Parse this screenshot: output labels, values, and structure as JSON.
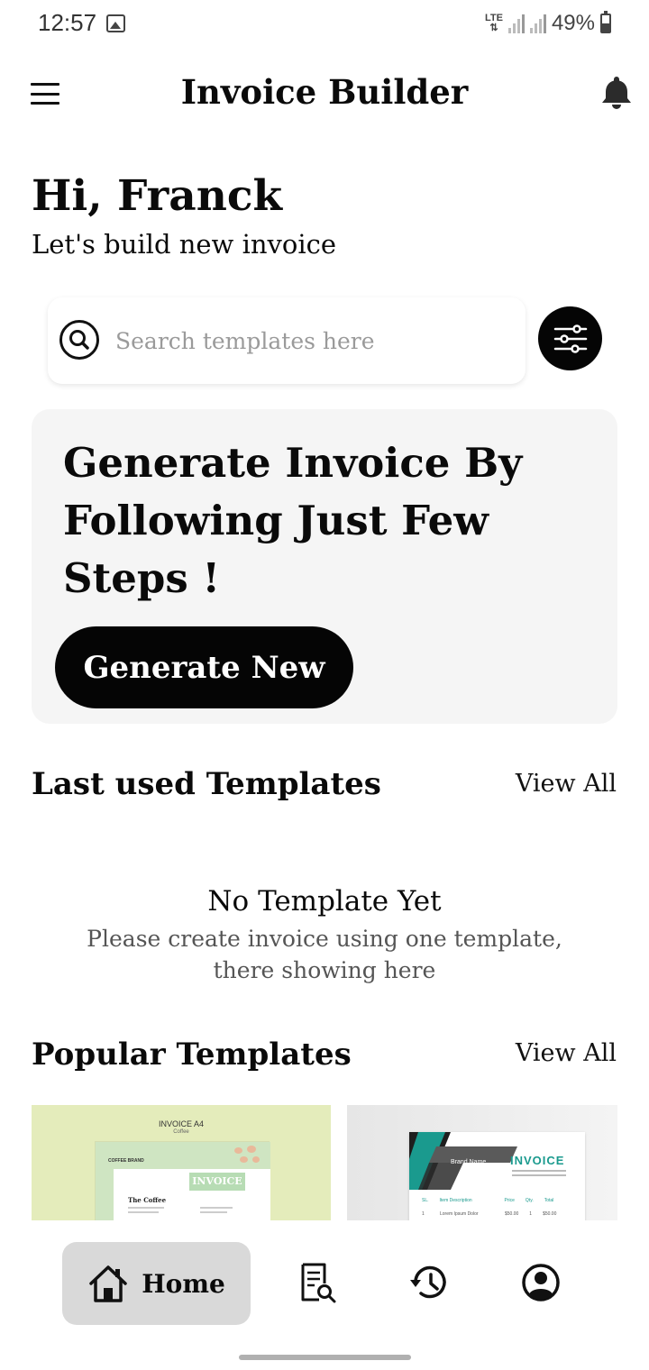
{
  "status_bar": {
    "time": "12:57",
    "network": "LTE",
    "battery": "49%"
  },
  "header": {
    "title": "Invoice Builder",
    "menu_icon": "hamburger-menu-icon",
    "notification_icon": "bell-icon"
  },
  "greeting": {
    "title": "Hi, Franck",
    "subtitle": "Let's build new invoice"
  },
  "search": {
    "placeholder": "Search templates here",
    "value": "",
    "filter_icon": "sliders-icon"
  },
  "banner": {
    "title": "Generate Invoice By Following Just Few Steps !",
    "button_label": "Generate New"
  },
  "last_used": {
    "title": "Last used Templates",
    "view_all": "View All",
    "empty_title": "No Template Yet",
    "empty_text": "Please create invoice using one template, there showing here"
  },
  "popular": {
    "title": "Popular Templates",
    "view_all": "View All",
    "templates": [
      {
        "header": "INVOICE A4",
        "subheader": "Coffee",
        "brand": "COFFEE BRAND",
        "heading": "INVOICE",
        "name": "The Coffee"
      },
      {
        "brand": "Brand Name",
        "heading": "INVOICE",
        "columns": [
          "SL.",
          "Item Description",
          "Price",
          "Qty.",
          "Total"
        ],
        "row": [
          "1",
          "Lorem Ipsum Dolor",
          "$50.00",
          "1",
          "$50.00"
        ]
      }
    ]
  },
  "bottom_nav": {
    "home_label": "Home",
    "items": [
      "home-icon",
      "invoice-search-icon",
      "history-icon",
      "profile-icon"
    ]
  },
  "colors": {
    "primary": "#050505",
    "banner_bg": "#f5f5f5",
    "nav_active_bg": "#d9d9d9",
    "card_green": "#e4ecbb",
    "card_teal": "#1a9a8e"
  }
}
